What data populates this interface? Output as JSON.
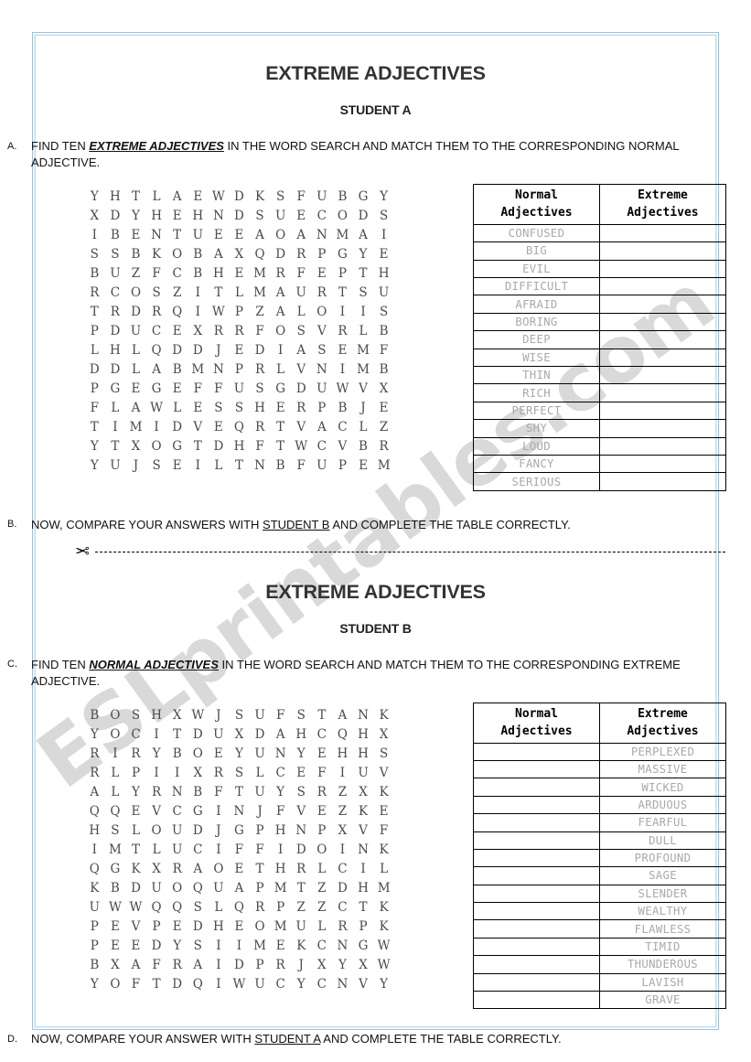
{
  "watermark": {
    "text": "ESLprintables.com",
    "color": "#d3d3d3"
  },
  "page": {
    "border_color": "#9cc0e0"
  },
  "icons": {
    "scissors": "✂"
  },
  "student_a": {
    "title": "EXTREME ADJECTIVES",
    "subtitle": "STUDENT A",
    "instruction_a": {
      "letter": "A.",
      "part1": "FIND TEN ",
      "emphasis": "EXTREME ADJECTIVES",
      "part2": " IN THE WORD SEARCH AND MATCH THEM TO THE CORRESPONDING NORMAL ADJECTIVE."
    },
    "instruction_b": {
      "letter": "B.",
      "part1": "NOW, COMPARE YOUR ANSWERS WITH ",
      "underlined": "STUDENT B",
      "part2": " AND COMPLETE THE TABLE CORRECTLY."
    },
    "grid": [
      [
        "Y",
        "H",
        "T",
        "L",
        "A",
        "E",
        "W",
        "D",
        "K",
        "S",
        "F",
        "U",
        "B",
        "G",
        "Y"
      ],
      [
        "X",
        "D",
        "Y",
        "H",
        "E",
        "H",
        "N",
        "D",
        "S",
        "U",
        "E",
        "C",
        "O",
        "D",
        "S"
      ],
      [
        "I",
        "B",
        "E",
        "N",
        "T",
        "U",
        "E",
        "E",
        "A",
        "O",
        "A",
        "N",
        "M",
        "A",
        "I"
      ],
      [
        "S",
        "S",
        "B",
        "K",
        "O",
        "B",
        "A",
        "X",
        "Q",
        "D",
        "R",
        "P",
        "G",
        "Y",
        "E"
      ],
      [
        "B",
        "U",
        "Z",
        "F",
        "C",
        "B",
        "H",
        "E",
        "M",
        "R",
        "F",
        "E",
        "P",
        "T",
        "H"
      ],
      [
        "R",
        "C",
        "O",
        "S",
        "Z",
        "I",
        "T",
        "L",
        "M",
        "A",
        "U",
        "R",
        "T",
        "S",
        "U"
      ],
      [
        "T",
        "R",
        "D",
        "R",
        "Q",
        "I",
        "W",
        "P",
        "Z",
        "A",
        "L",
        "O",
        "I",
        "I",
        "S"
      ],
      [
        "P",
        "D",
        "U",
        "C",
        "E",
        "X",
        "R",
        "R",
        "F",
        "O",
        "S",
        "V",
        "R",
        "L",
        "B"
      ],
      [
        "L",
        "H",
        "L",
        "Q",
        "D",
        "D",
        "J",
        "E",
        "D",
        "I",
        "A",
        "S",
        "E",
        "M",
        "F"
      ],
      [
        "D",
        "D",
        "L",
        "A",
        "B",
        "M",
        "N",
        "P",
        "R",
        "L",
        "V",
        "N",
        "I",
        "M",
        "B"
      ],
      [
        "P",
        "G",
        "E",
        "G",
        "E",
        "F",
        "F",
        "U",
        "S",
        "G",
        "D",
        "U",
        "W",
        "V",
        "X"
      ],
      [
        "F",
        "L",
        "A",
        "W",
        "L",
        "E",
        "S",
        "S",
        "H",
        "E",
        "R",
        "P",
        "B",
        "J",
        "E"
      ],
      [
        "T",
        "I",
        "M",
        "I",
        "D",
        "V",
        "E",
        "Q",
        "R",
        "T",
        "V",
        "A",
        "C",
        "L",
        "Z"
      ],
      [
        "Y",
        "T",
        "X",
        "O",
        "G",
        "T",
        "D",
        "H",
        "F",
        "T",
        "W",
        "C",
        "V",
        "B",
        "R"
      ],
      [
        "Y",
        "U",
        "J",
        "S",
        "E",
        "I",
        "L",
        "T",
        "N",
        "B",
        "F",
        "U",
        "P",
        "E",
        "M"
      ]
    ],
    "table": {
      "header_normal_line1": "Normal",
      "header_normal_line2": "Adjectives",
      "header_extreme_line1": "Extreme",
      "header_extreme_line2": "Adjectives",
      "rows": [
        {
          "normal": "CONFUSED",
          "extreme": ""
        },
        {
          "normal": "BIG",
          "extreme": ""
        },
        {
          "normal": "EVIL",
          "extreme": ""
        },
        {
          "normal": "DIFFICULT",
          "extreme": ""
        },
        {
          "normal": "AFRAID",
          "extreme": ""
        },
        {
          "normal": "BORING",
          "extreme": ""
        },
        {
          "normal": "DEEP",
          "extreme": ""
        },
        {
          "normal": "WISE",
          "extreme": ""
        },
        {
          "normal": "THIN",
          "extreme": ""
        },
        {
          "normal": "RICH",
          "extreme": ""
        },
        {
          "normal": "PERFECT",
          "extreme": ""
        },
        {
          "normal": "SHY",
          "extreme": ""
        },
        {
          "normal": "LOUD",
          "extreme": ""
        },
        {
          "normal": "FANCY",
          "extreme": ""
        },
        {
          "normal": "SERIOUS",
          "extreme": ""
        }
      ]
    }
  },
  "student_b": {
    "title": "EXTREME ADJECTIVES",
    "subtitle": "STUDENT B",
    "instruction_c": {
      "letter": "C.",
      "part1": "FIND TEN ",
      "emphasis": "NORMAL ADJECTIVES",
      "part2": " IN THE WORD SEARCH AND MATCH THEM TO THE CORRESPONDING EXTREME ADJECTIVE."
    },
    "instruction_d": {
      "letter": "D.",
      "part1": "NOW, COMPARE YOUR ANSWER WITH ",
      "underlined": "STUDENT A",
      "part2": " AND COMPLETE THE TABLE CORRECTLY."
    },
    "grid": [
      [
        "B",
        "O",
        "S",
        "H",
        "X",
        "W",
        "J",
        "S",
        "U",
        "F",
        "S",
        "T",
        "A",
        "N",
        "K"
      ],
      [
        "Y",
        "O",
        "C",
        "I",
        "T",
        "D",
        "U",
        "X",
        "D",
        "A",
        "H",
        "C",
        "Q",
        "H",
        "X"
      ],
      [
        "R",
        "I",
        "R",
        "Y",
        "B",
        "O",
        "E",
        "Y",
        "U",
        "N",
        "Y",
        "E",
        "H",
        "H",
        "S"
      ],
      [
        "R",
        "L",
        "P",
        "I",
        "I",
        "X",
        "R",
        "S",
        "L",
        "C",
        "E",
        "F",
        "I",
        "U",
        "V"
      ],
      [
        "A",
        "L",
        "Y",
        "R",
        "N",
        "B",
        "F",
        "T",
        "U",
        "Y",
        "S",
        "R",
        "Z",
        "X",
        "K"
      ],
      [
        "Q",
        "Q",
        "E",
        "V",
        "C",
        "G",
        "I",
        "N",
        "J",
        "F",
        "V",
        "E",
        "Z",
        "K",
        "E"
      ],
      [
        "H",
        "S",
        "L",
        "O",
        "U",
        "D",
        "J",
        "G",
        "P",
        "H",
        "N",
        "P",
        "X",
        "V",
        "F"
      ],
      [
        "I",
        "M",
        "T",
        "L",
        "U",
        "C",
        "I",
        "F",
        "F",
        "I",
        "D",
        "O",
        "I",
        "N",
        "K"
      ],
      [
        "Q",
        "G",
        "K",
        "X",
        "R",
        "A",
        "O",
        "E",
        "T",
        "H",
        "R",
        "L",
        "C",
        "I",
        "L"
      ],
      [
        "K",
        "B",
        "D",
        "U",
        "O",
        "Q",
        "U",
        "A",
        "P",
        "M",
        "T",
        "Z",
        "D",
        "H",
        "M"
      ],
      [
        "U",
        "W",
        "W",
        "Q",
        "Q",
        "S",
        "L",
        "Q",
        "R",
        "P",
        "Z",
        "Z",
        "C",
        "T",
        "K"
      ],
      [
        "P",
        "E",
        "V",
        "P",
        "E",
        "D",
        "H",
        "E",
        "O",
        "M",
        "U",
        "L",
        "R",
        "P",
        "K"
      ],
      [
        "P",
        "E",
        "E",
        "D",
        "Y",
        "S",
        "I",
        "I",
        "M",
        "E",
        "K",
        "C",
        "N",
        "G",
        "W"
      ],
      [
        "B",
        "X",
        "A",
        "F",
        "R",
        "A",
        "I",
        "D",
        "P",
        "R",
        "J",
        "X",
        "Y",
        "X",
        "W"
      ],
      [
        "Y",
        "O",
        "F",
        "T",
        "D",
        "Q",
        "I",
        "W",
        "U",
        "C",
        "Y",
        "C",
        "N",
        "V",
        "Y"
      ]
    ],
    "table": {
      "header_normal_line1": "Normal",
      "header_normal_line2": "Adjectives",
      "header_extreme_line1": "Extreme",
      "header_extreme_line2": "Adjectives",
      "rows": [
        {
          "normal": "",
          "extreme": "PERPLEXED"
        },
        {
          "normal": "",
          "extreme": "MASSIVE"
        },
        {
          "normal": "",
          "extreme": "WICKED"
        },
        {
          "normal": "",
          "extreme": "ARDUOUS"
        },
        {
          "normal": "",
          "extreme": "FEARFUL"
        },
        {
          "normal": "",
          "extreme": "DULL"
        },
        {
          "normal": "",
          "extreme": "PROFOUND"
        },
        {
          "normal": "",
          "extreme": "SAGE"
        },
        {
          "normal": "",
          "extreme": "SLENDER"
        },
        {
          "normal": "",
          "extreme": "WEALTHY"
        },
        {
          "normal": "",
          "extreme": "FLAWLESS"
        },
        {
          "normal": "",
          "extreme": "TIMID"
        },
        {
          "normal": "",
          "extreme": "THUNDEROUS"
        },
        {
          "normal": "",
          "extreme": "LAVISH"
        },
        {
          "normal": "",
          "extreme": "GRAVE"
        }
      ]
    }
  }
}
